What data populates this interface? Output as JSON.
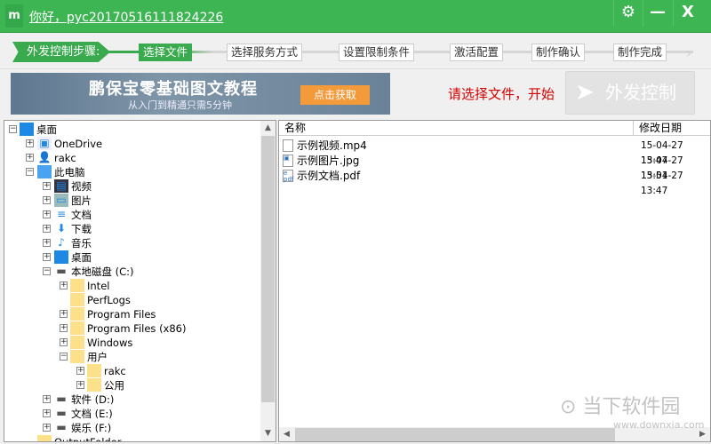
{
  "titlebar": {
    "logo": "m",
    "greeting": "你好，pyc20170516111824226",
    "settings_icon": "gear-icon",
    "minimize": "—",
    "close": "X",
    "color": "#3db553"
  },
  "steps": {
    "label": "外发控制步骤:",
    "items": [
      "选择文件",
      "选择服务方式",
      "设置限制条件",
      "激活配置",
      "制作确认",
      "制作完成"
    ],
    "active_index": 0
  },
  "banner": {
    "title": "鹏保宝零基础图文教程",
    "subtitle": "从入门到精通只需5分钟",
    "button": "点击获取"
  },
  "hint": "请选择文件，开始",
  "send_button": "外发控制",
  "tree": [
    {
      "label": "桌面",
      "level": 0,
      "expand": "-",
      "icon": "desktop"
    },
    {
      "label": "OneDrive",
      "level": 1,
      "expand": "+",
      "icon": "onedrive"
    },
    {
      "label": "rakc",
      "level": 1,
      "expand": "+",
      "icon": "user"
    },
    {
      "label": "此电脑",
      "level": 1,
      "expand": "-",
      "icon": "computer"
    },
    {
      "label": "视频",
      "level": 2,
      "expand": "+",
      "icon": "video"
    },
    {
      "label": "图片",
      "level": 2,
      "expand": "+",
      "icon": "picture"
    },
    {
      "label": "文档",
      "level": 2,
      "expand": "+",
      "icon": "document"
    },
    {
      "label": "下载",
      "level": 2,
      "expand": "+",
      "icon": "download"
    },
    {
      "label": "音乐",
      "level": 2,
      "expand": "+",
      "icon": "music"
    },
    {
      "label": "桌面",
      "level": 2,
      "expand": "+",
      "icon": "desktop"
    },
    {
      "label": "本地磁盘 (C:)",
      "level": 2,
      "expand": "-",
      "icon": "drive"
    },
    {
      "label": "Intel",
      "level": 3,
      "expand": "+",
      "icon": "folder"
    },
    {
      "label": "PerfLogs",
      "level": 3,
      "expand": "",
      "icon": "folder"
    },
    {
      "label": "Program Files",
      "level": 3,
      "expand": "+",
      "icon": "folder"
    },
    {
      "label": "Program Files (x86)",
      "level": 3,
      "expand": "+",
      "icon": "folder"
    },
    {
      "label": "Windows",
      "level": 3,
      "expand": "+",
      "icon": "folder"
    },
    {
      "label": "用户",
      "level": 3,
      "expand": "-",
      "icon": "folder"
    },
    {
      "label": "rakc",
      "level": 4,
      "expand": "+",
      "icon": "folder"
    },
    {
      "label": "公用",
      "level": 4,
      "expand": "+",
      "icon": "folder"
    },
    {
      "label": "软件 (D:)",
      "level": 2,
      "expand": "+",
      "icon": "drive"
    },
    {
      "label": "文档 (E:)",
      "level": 2,
      "expand": "+",
      "icon": "drive"
    },
    {
      "label": "娱乐 (F:)",
      "level": 2,
      "expand": "+",
      "icon": "drive"
    },
    {
      "label": "OutputFolder",
      "level": 1,
      "expand": "",
      "icon": "folder"
    }
  ],
  "list": {
    "columns": [
      "名称",
      "修改日期"
    ],
    "rows": [
      {
        "name": "示例视频.mp4",
        "date": "15-04-27 13:47",
        "icon": "file"
      },
      {
        "name": "示例图片.jpg",
        "date": "15-04-27 13:51",
        "icon": "image"
      },
      {
        "name": "示例文档.pdf",
        "date": "15-04-27 13:47",
        "icon": "pdf"
      }
    ]
  },
  "watermark": {
    "text": "当下软件园",
    "url": "www.downxia.com"
  }
}
